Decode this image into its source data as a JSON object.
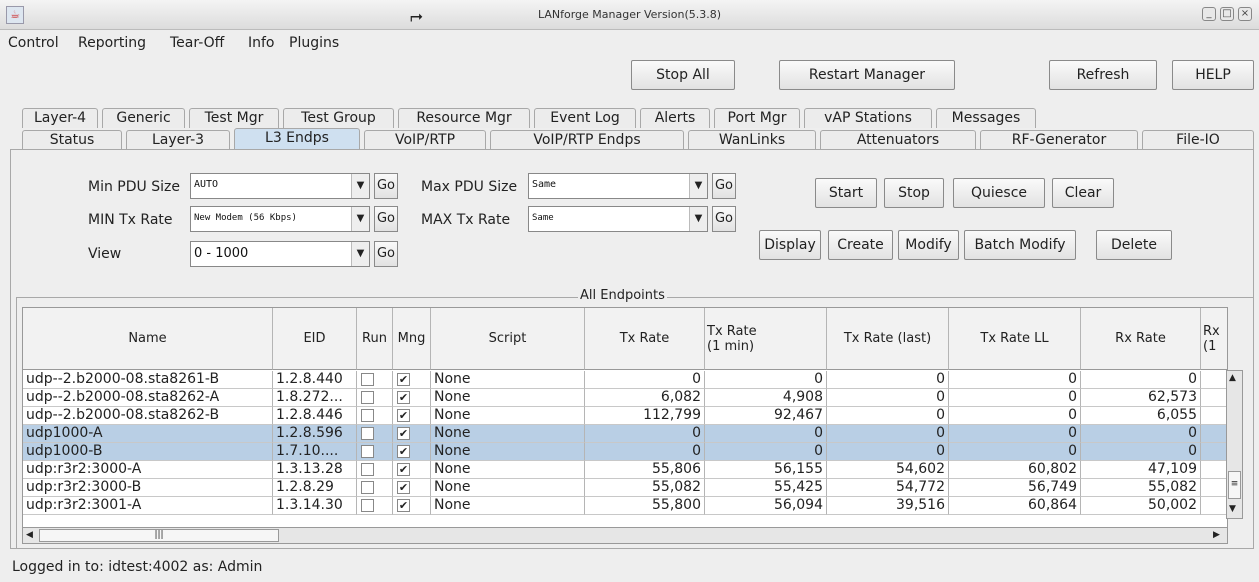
{
  "window": {
    "title": "LANforge Manager   Version(5.3.8)",
    "app_icon": "java-icon"
  },
  "menu": [
    "Control",
    "Reporting",
    "Tear-Off",
    "Info",
    "Plugins"
  ],
  "toolbar": {
    "stop_all": "Stop All",
    "restart_manager": "Restart Manager",
    "refresh": "Refresh",
    "help": "HELP"
  },
  "tabs_row1": [
    "Layer-4",
    "Generic",
    "Test Mgr",
    "Test Group",
    "Resource Mgr",
    "Event Log",
    "Alerts",
    "Port Mgr",
    "vAP Stations",
    "Messages"
  ],
  "tabs_row2": [
    "Status",
    "Layer-3",
    "L3 Endps",
    "VoIP/RTP",
    "VoIP/RTP Endps",
    "WanLinks",
    "Attenuators",
    "RF-Generator",
    "File-IO"
  ],
  "selected_tab": "L3 Endps",
  "controls": {
    "min_pdu_label": "Min PDU Size",
    "min_pdu_value": "AUTO",
    "max_pdu_label": "Max PDU Size",
    "max_pdu_value": "Same",
    "min_tx_label": "MIN Tx Rate",
    "min_tx_value": "New Modem (56 Kbps)",
    "max_tx_label": "MAX Tx Rate",
    "max_tx_value": "Same",
    "view_label": "View",
    "view_value": "0 - 1000",
    "go": "Go"
  },
  "actions": {
    "start": "Start",
    "stop": "Stop",
    "quiesce": "Quiesce",
    "clear": "Clear",
    "display": "Display",
    "create": "Create",
    "modify": "Modify",
    "batch_modify": "Batch Modify",
    "delete": "Delete"
  },
  "table": {
    "title": "All Endpoints",
    "columns": [
      "Name",
      "EID",
      "Run",
      "Mng",
      "Script",
      "Tx Rate",
      "Tx Rate\n(1 min)",
      "Tx Rate (last)",
      "Tx Rate LL",
      "Rx Rate",
      "Rx\n(1"
    ],
    "rows": [
      {
        "name": "udp--2.b2000-08.sta8261-B",
        "eid": "1.2.8.440",
        "script": "None",
        "tx": "0",
        "tx1": "0",
        "txl": "0",
        "txll": "0",
        "rx": "0",
        "sel": false
      },
      {
        "name": "udp--2.b2000-08.sta8262-A",
        "eid": "1.8.272...",
        "script": "None",
        "tx": "6,082",
        "tx1": "4,908",
        "txl": "0",
        "txll": "0",
        "rx": "62,573",
        "sel": false
      },
      {
        "name": "udp--2.b2000-08.sta8262-B",
        "eid": "1.2.8.446",
        "script": "None",
        "tx": "112,799",
        "tx1": "92,467",
        "txl": "0",
        "txll": "0",
        "rx": "6,055",
        "sel": false
      },
      {
        "name": "udp1000-A",
        "eid": "1.2.8.596",
        "script": "None",
        "tx": "0",
        "tx1": "0",
        "txl": "0",
        "txll": "0",
        "rx": "0",
        "sel": true
      },
      {
        "name": "udp1000-B",
        "eid": "1.7.10....",
        "script": "None",
        "tx": "0",
        "tx1": "0",
        "txl": "0",
        "txll": "0",
        "rx": "0",
        "sel": true
      },
      {
        "name": "udp:r3r2:3000-A",
        "eid": "1.3.13.28",
        "script": "None",
        "tx": "55,806",
        "tx1": "56,155",
        "txl": "54,602",
        "txll": "60,802",
        "rx": "47,109",
        "sel": false
      },
      {
        "name": "udp:r3r2:3000-B",
        "eid": "1.2.8.29",
        "script": "None",
        "tx": "55,082",
        "tx1": "55,425",
        "txl": "54,772",
        "txll": "56,749",
        "rx": "55,082",
        "sel": false
      },
      {
        "name": "udp:r3r2:3001-A",
        "eid": "1.3.14.30",
        "script": "None",
        "tx": "55,800",
        "tx1": "56,094",
        "txl": "39,516",
        "txll": "60,864",
        "rx": "50,002",
        "sel": false
      }
    ]
  },
  "status": "Logged in to:  idtest:4002  as:  Admin"
}
